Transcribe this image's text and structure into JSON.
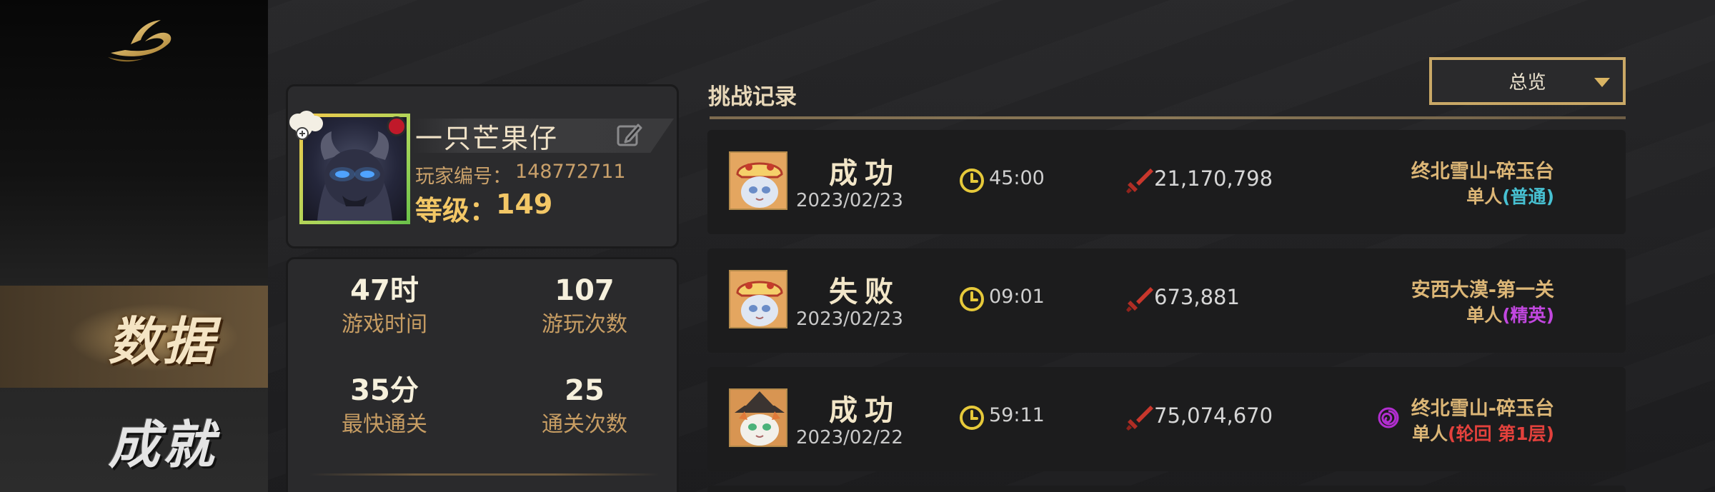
{
  "sidebar": {
    "logo": "gold-swirl-logo",
    "items": [
      {
        "label": "数据",
        "active": true
      },
      {
        "label": "成就",
        "active": false
      }
    ]
  },
  "profile": {
    "name": "一只芒果仔",
    "id_label": "玩家编号：",
    "id_value": "148772711",
    "level_label": "等级：",
    "level_value": "149"
  },
  "stats": [
    {
      "value": "47时",
      "label": "游戏时间"
    },
    {
      "value": "107",
      "label": "游玩次数"
    },
    {
      "value": "35分",
      "label": "最快通关"
    },
    {
      "value": "25",
      "label": "通关次数"
    }
  ],
  "records_section": {
    "title": "挑战记录",
    "filter": {
      "selected": "总览"
    }
  },
  "records": [
    {
      "result": "成功",
      "date": "2023/02/23",
      "time": "45:00",
      "damage": "21,170,798",
      "stage": "终北雪山-碎玉台",
      "mode_prefix": "单人",
      "mode_open": "(",
      "mode_value": "普通",
      "mode_close": ")"
    },
    {
      "result": "失败",
      "date": "2023/02/23",
      "time": "09:01",
      "damage": "673,881",
      "stage": "安西大漠-第一关",
      "mode_prefix": "单人",
      "mode_open": "(",
      "mode_value": "精英",
      "mode_close": ")"
    },
    {
      "result": "成功",
      "date": "2023/02/22",
      "time": "59:11",
      "damage": "75,074,670",
      "stage": "终北雪山-碎玉台",
      "mode_prefix": "单人",
      "mode_open": "(",
      "mode_value": "轮回  第1层",
      "mode_close": ")"
    }
  ],
  "colors": {
    "gold": "#c9a866",
    "mode_normal": "#47c1d2",
    "mode_elite": "#c247e0",
    "mode_cycle": "#e3413c"
  }
}
